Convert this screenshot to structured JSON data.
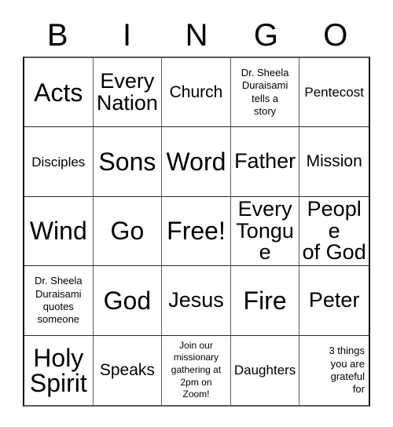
{
  "card": {
    "title": "BINGO",
    "header_letters": [
      "B",
      "I",
      "N",
      "G",
      "O"
    ],
    "columns": 5,
    "rows": 5,
    "grid_line_color": "#2a2a2c",
    "background_color": "#ffffff",
    "text_color": "#000000"
  },
  "cells": [
    {
      "text": "Acts",
      "size": "xl",
      "row": 1,
      "col": 1
    },
    {
      "text": "Every\nNation",
      "size": "lg",
      "row": 1,
      "col": 2
    },
    {
      "text": "Church",
      "size": "md",
      "row": 1,
      "col": 3
    },
    {
      "text": "Dr. Sheela\nDuraisami\ntells a\nstory",
      "size": "xs",
      "row": 1,
      "col": 4
    },
    {
      "text": "Pentecost",
      "size": "sm",
      "row": 1,
      "col": 5
    },
    {
      "text": "Disciples",
      "size": "sm",
      "row": 2,
      "col": 1
    },
    {
      "text": "Sons",
      "size": "xl",
      "row": 2,
      "col": 2
    },
    {
      "text": "Word",
      "size": "xl",
      "row": 2,
      "col": 3
    },
    {
      "text": "Father",
      "size": "lg",
      "row": 2,
      "col": 4
    },
    {
      "text": "Mission",
      "size": "md",
      "row": 2,
      "col": 5
    },
    {
      "text": "Wind",
      "size": "xl",
      "row": 3,
      "col": 1
    },
    {
      "text": "Go",
      "size": "xl",
      "row": 3,
      "col": 2
    },
    {
      "text": "Free!",
      "size": "xl",
      "row": 3,
      "col": 3
    },
    {
      "text": "Every\nTongue",
      "size": "lg",
      "row": 3,
      "col": 4
    },
    {
      "text": "People\nof God",
      "size": "lg",
      "row": 3,
      "col": 5
    },
    {
      "text": "Dr. Sheela\nDuraisami\nquotes\nsomeone",
      "size": "xs",
      "row": 4,
      "col": 1
    },
    {
      "text": "God",
      "size": "xl",
      "row": 4,
      "col": 2
    },
    {
      "text": "Jesus",
      "size": "lg",
      "row": 4,
      "col": 3
    },
    {
      "text": "Fire",
      "size": "xl",
      "row": 4,
      "col": 4
    },
    {
      "text": "Peter",
      "size": "lg",
      "row": 4,
      "col": 5
    },
    {
      "text": "Holy\nSpirit",
      "size": "xl",
      "row": 5,
      "col": 1
    },
    {
      "text": "Speaks",
      "size": "md",
      "row": 5,
      "col": 2
    },
    {
      "text": "Join our\nmissionary\ngathering at\n2pm on\nZoom!",
      "size": "xxs",
      "row": 5,
      "col": 3
    },
    {
      "text": "Daughters",
      "size": "sm",
      "row": 5,
      "col": 4
    },
    {
      "text": "3 things\nyou are\ngrateful\nfor",
      "size": "xs",
      "row": 5,
      "col": 5,
      "align": "right"
    }
  ]
}
